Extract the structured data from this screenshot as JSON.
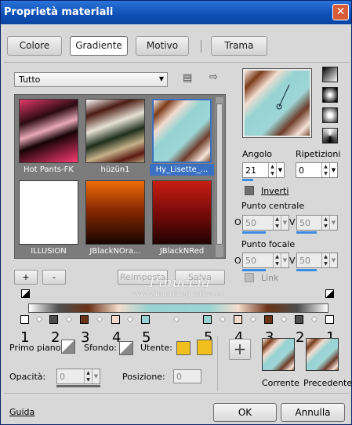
{
  "window": {
    "title": "Proprietà materiali"
  },
  "tabs": [
    {
      "label": "Colore"
    },
    {
      "label": "Gradiente"
    },
    {
      "label": "Motivo"
    },
    {
      "label": "Trama"
    }
  ],
  "active_tab": "Gradiente",
  "category": {
    "selected": "Tutto"
  },
  "gallery": {
    "items": [
      {
        "label": "Hot Pants-FK"
      },
      {
        "label": "hüzün1"
      },
      {
        "label": "Hy_Lisette_..."
      },
      {
        "label": "ILLUSION"
      },
      {
        "label": "JBlackNOra..."
      },
      {
        "label": "JBlackNRed"
      }
    ],
    "selected": "Hy_Lisette_..."
  },
  "gallery_buttons": {
    "add": "+",
    "remove": "-",
    "reset": "Reimposta",
    "save": "Salva"
  },
  "angle": {
    "label": "Angolo",
    "value": "21"
  },
  "repeats": {
    "label": "Ripetizioni",
    "value": "0"
  },
  "invert": {
    "label": "Inverti",
    "checked": true
  },
  "center_point": {
    "label": "Punto centrale",
    "x_label": "O",
    "x": "50",
    "y_label": "V",
    "y": "50"
  },
  "focal_point": {
    "label": "Punto focale",
    "x_label": "O",
    "x": "50",
    "y_label": "V",
    "y": "50"
  },
  "link": {
    "label": "Link",
    "checked": false,
    "enabled": false
  },
  "watermark": {
    "line1": "Pinuccia",
    "line2": "www.maidiregrafica.eu"
  },
  "stop_numbers": [
    "1",
    "2",
    "3",
    "4",
    "5",
    "5",
    "4",
    "3",
    "2",
    "1"
  ],
  "colors": {
    "foreground": {
      "label": "Primo piano:"
    },
    "background": {
      "label": "Sfondo:"
    },
    "user": {
      "label": "Utente:",
      "color": "#f2c01e"
    }
  },
  "opacity": {
    "label": "Opacità:",
    "value": "0"
  },
  "position": {
    "label": "Posizione:",
    "value": "0"
  },
  "previews": {
    "add": "+",
    "current": "Corrente",
    "previous": "Precedente"
  },
  "footer": {
    "help": "Guida",
    "ok": "OK",
    "cancel": "Annulla"
  }
}
